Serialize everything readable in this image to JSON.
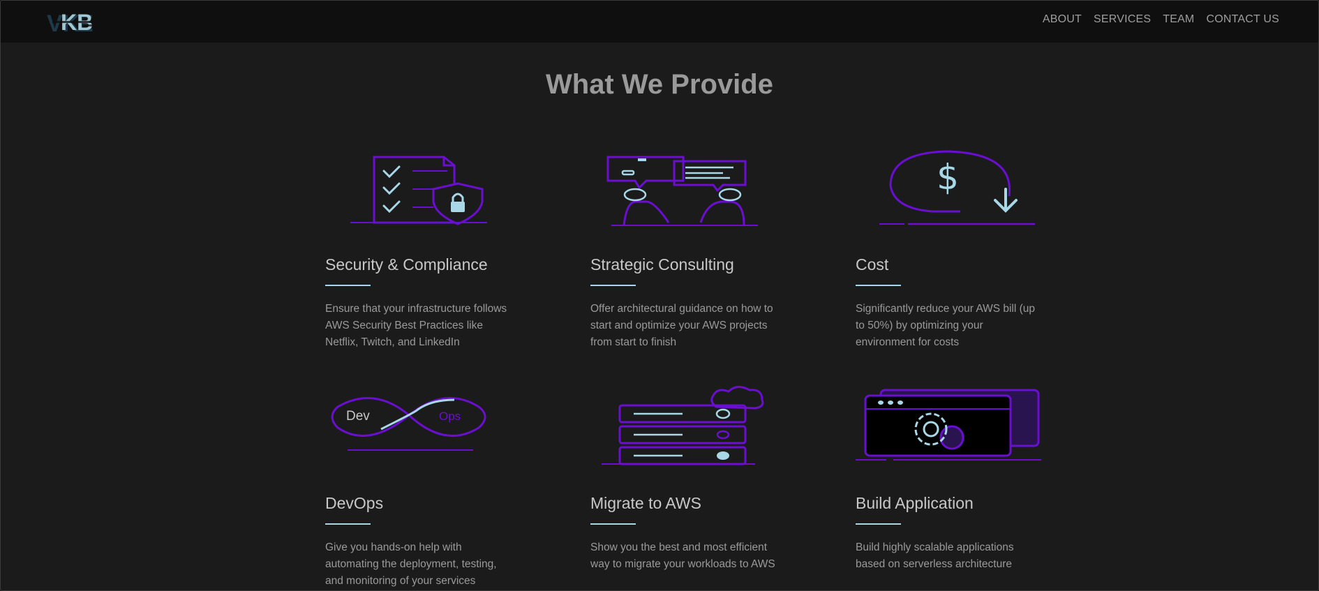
{
  "nav": {
    "links": [
      "ABOUT",
      "SERVICES",
      "TEAM",
      "CONTACT US"
    ]
  },
  "section": {
    "title": "What We Provide"
  },
  "services": [
    {
      "title": "Security & Compliance",
      "description": "Ensure that your infrastructure follows AWS Security Best Practices like Netflix, Twitch, and LinkedIn",
      "icon": "security-checklist-shield-icon"
    },
    {
      "title": "Strategic Consulting",
      "description": "Offer architectural guidance on how to start and optimize your AWS projects from start to finish",
      "icon": "consulting-chat-icon"
    },
    {
      "title": "Cost",
      "description": "Significantly reduce your AWS bill (up to 50%) by optimizing your environment for costs",
      "icon": "cost-reduction-dollar-icon"
    },
    {
      "title": "DevOps",
      "description": "Give you hands-on help with automating the deployment, testing, and monitoring of your services",
      "icon": "devops-infinity-icon",
      "icon_labels": {
        "dev": "Dev",
        "ops": "Ops"
      }
    },
    {
      "title": "Migrate to AWS",
      "description": "Show you the best and most efficient way to migrate your workloads to AWS",
      "icon": "server-cloud-icon"
    },
    {
      "title": "Build Application",
      "description": "Build highly scalable applications based on serverless architecture",
      "icon": "app-window-gear-icon"
    }
  ],
  "colors": {
    "background": "#1b1b1b",
    "navbar": "#0f0f0f",
    "accent_purple": "#6a0fd0",
    "accent_cyan": "#a8d8e8"
  }
}
